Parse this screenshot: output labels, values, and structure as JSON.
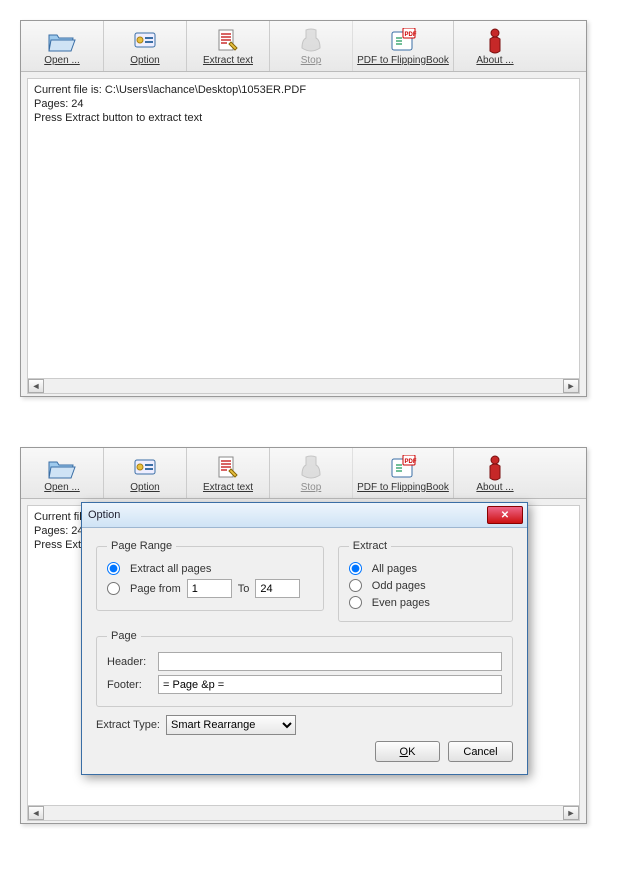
{
  "toolbar": {
    "open": "Open ...",
    "option": "Option",
    "extract": "Extract text",
    "stop": "Stop",
    "pdf2fb": "PDF to FlippingBook",
    "about": "About ..."
  },
  "status": {
    "line1": "Current file is: C:\\Users\\lachance\\Desktop\\1053ER.PDF",
    "line2": "Pages: 24",
    "line3": "Press Extract button to extract text"
  },
  "status_partial": {
    "line1": "Current file is: C",
    "line2": "Pages: 24",
    "line3": "Press Extract b"
  },
  "dialog": {
    "title": "Option",
    "page_range_legend": "Page Range",
    "extract_all_label": "Extract all pages",
    "page_from_label": "Page from",
    "to_label": "To",
    "from_value": "1",
    "to_value": "24",
    "extract_legend": "Extract",
    "all_pages": "All pages",
    "odd_pages": "Odd pages",
    "even_pages": "Even pages",
    "page_legend": "Page",
    "header_label": "Header:",
    "header_value": "",
    "footer_label": "Footer:",
    "footer_value": "= Page &p =",
    "extract_type_label": "Extract Type:",
    "extract_type_value": "Smart Rearrange",
    "ok": "OK",
    "cancel": "Cancel"
  }
}
